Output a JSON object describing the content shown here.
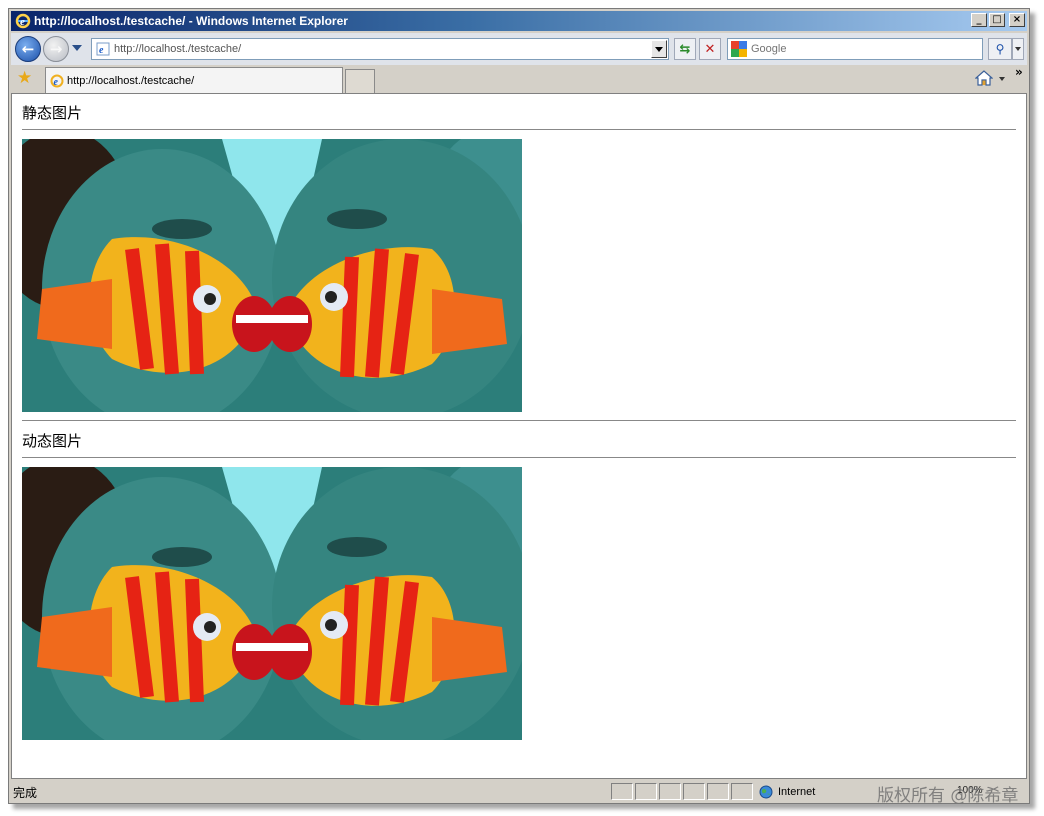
{
  "window": {
    "title": "http://localhost./testcache/ - Windows Internet Explorer",
    "minimize_label": "_",
    "maximize_label": "□",
    "close_label": "×"
  },
  "toolbar": {
    "address": "http://localhost./testcache/",
    "search_placeholder": "Google",
    "refresh_glyph": "⇆",
    "stop_glyph": "✕",
    "search_go_glyph": "⚲",
    "chevrons": "»"
  },
  "tabs": [
    {
      "title": "http://localhost./testcache/"
    }
  ],
  "page": {
    "static_heading": "静态图片",
    "dynamic_heading": "动态图片"
  },
  "status": {
    "text": "完成",
    "zone": "Internet",
    "zoom": "100%",
    "watermark": "版权所有 @陈希章"
  },
  "colors": {
    "title_gradient_start": "#0a246a",
    "title_gradient_end": "#a6caf0",
    "chrome": "#d4d0c8"
  },
  "icons": [
    "ie-icon",
    "back-icon",
    "forward-icon",
    "refresh-icon",
    "stop-icon",
    "google-icon",
    "search-icon",
    "favorites-star-icon",
    "home-icon",
    "globe-icon"
  ]
}
